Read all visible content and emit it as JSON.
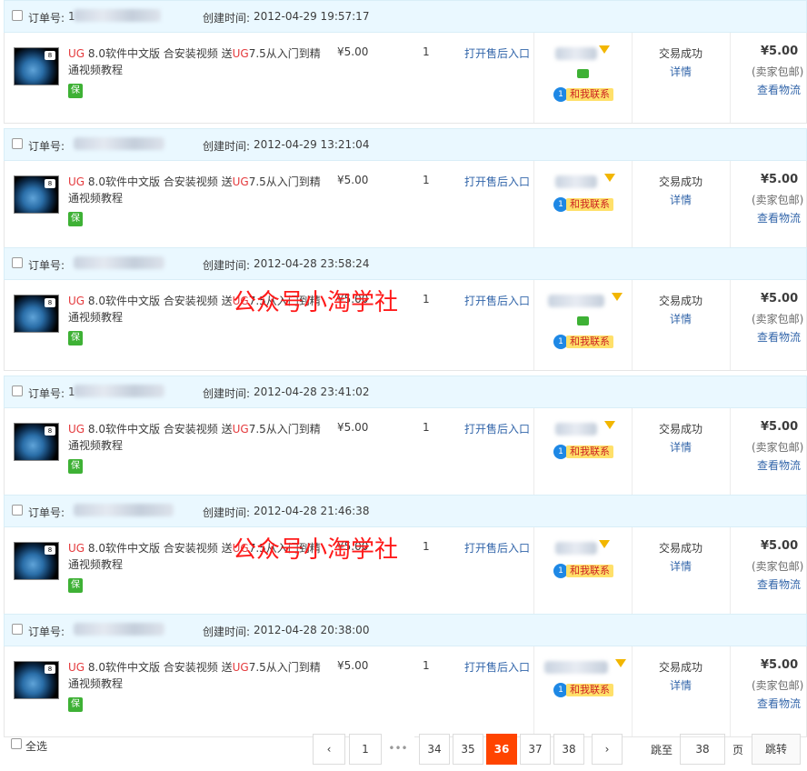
{
  "labels": {
    "order_no": "订单号:",
    "created": "创建时间:",
    "aftersale": "打开售后入口",
    "contact": "和我联系",
    "status": "交易成功",
    "detail": "详情",
    "shipping": "(卖家包邮)",
    "logistics": "查看物流",
    "thumb_badge": "8",
    "service_icon": "保",
    "contact_bubble": "1"
  },
  "product": {
    "title_parts": [
      "UG",
      " 8.0软件中文版 合安装视频 送",
      "UG",
      "7.5从入门到精通视频教程"
    ],
    "price": "¥5.00",
    "qty": "1",
    "total": "¥5.00"
  },
  "orders": [
    {
      "order_prefix": "1",
      "created": "2012-04-29 19:57:17",
      "has_msg": true
    },
    {
      "order_prefix": "",
      "created": "2012-04-29 13:21:04",
      "has_msg": false
    },
    {
      "order_prefix": "",
      "created": "2012-04-28 23:58:24",
      "has_msg": true
    },
    {
      "order_prefix": "1",
      "created": "2012-04-28 23:41:02",
      "has_msg": false
    },
    {
      "order_prefix": "",
      "created": "2012-04-28 21:46:38",
      "has_msg": false
    },
    {
      "order_prefix": "",
      "created": "2012-04-28 20:38:00",
      "has_msg": false
    }
  ],
  "watermark": "公众号小淘学社",
  "pagination": {
    "select_all": "全选",
    "prev": "‹",
    "next": "›",
    "pages": [
      "1",
      "•••",
      "34",
      "35",
      "36",
      "37",
      "38"
    ],
    "current": "36",
    "jump_label": "跳至",
    "jump_value": "38",
    "page_unit": "页",
    "jump_button": "跳转"
  },
  "colors": {
    "accent": "#ff4400",
    "link": "#3366aa",
    "highlight_red": "#e4393c",
    "header_bg": "#eaf8ff"
  }
}
